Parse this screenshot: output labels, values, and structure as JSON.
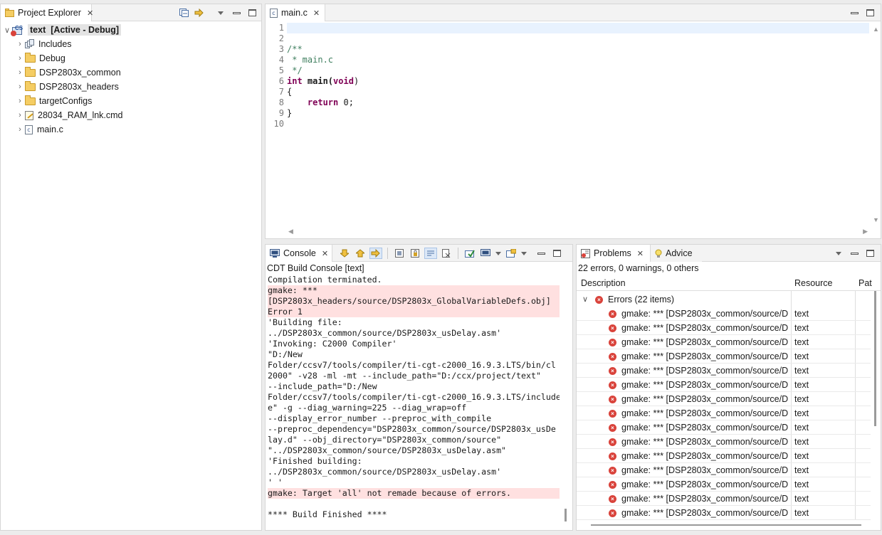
{
  "project_explorer": {
    "tab_label": "Project Explorer",
    "project": {
      "name": "text",
      "status": "[Active - Debug]"
    },
    "items": [
      {
        "label": "Includes",
        "icon": "includes-icon"
      },
      {
        "label": "Debug",
        "icon": "folder-icon"
      },
      {
        "label": "DSP2803x_common",
        "icon": "folder-icon"
      },
      {
        "label": "DSP2803x_headers",
        "icon": "folder-icon"
      },
      {
        "label": "targetConfigs",
        "icon": "folder-icon"
      },
      {
        "label": "28034_RAM_lnk.cmd",
        "icon": "linker-file-icon"
      },
      {
        "label": "main.c",
        "icon": "c-file-icon"
      }
    ]
  },
  "editor": {
    "tab_label": "main.c",
    "lines": [
      {
        "num": "1",
        "text": ""
      },
      {
        "num": "2",
        "text": ""
      },
      {
        "num": "3",
        "text": "/**"
      },
      {
        "num": "4",
        "text": " * main.c"
      },
      {
        "num": "5",
        "text": " */"
      },
      {
        "num": "6",
        "kw1": "int",
        "mid": " main(",
        "kw2": "void",
        "end": ")"
      },
      {
        "num": "7",
        "text": "{"
      },
      {
        "num": "8",
        "indent": "    ",
        "kw1": "return",
        "end": " 0;"
      },
      {
        "num": "9",
        "text": "}"
      },
      {
        "num": "10",
        "text": ""
      }
    ]
  },
  "console": {
    "tab_label": "Console",
    "title": "CDT Build Console [text]",
    "lines": [
      {
        "text": "Compilation terminated.",
        "error": false
      },
      {
        "text": "gmake: ***",
        "error": true
      },
      {
        "text": "[DSP2803x_headers/source/DSP2803x_GlobalVariableDefs.obj]",
        "error": true
      },
      {
        "text": "Error 1",
        "error": true
      },
      {
        "text": "'Building file:",
        "error": false
      },
      {
        "text": "../DSP2803x_common/source/DSP2803x_usDelay.asm'",
        "error": false
      },
      {
        "text": "'Invoking: C2000 Compiler'",
        "error": false
      },
      {
        "text": "\"D:/New",
        "error": false
      },
      {
        "text": "Folder/ccsv7/tools/compiler/ti-cgt-c2000_16.9.3.LTS/bin/cl",
        "error": false
      },
      {
        "text": "2000\" -v28 -ml -mt --include_path=\"D:/ccx/project/text\"",
        "error": false
      },
      {
        "text": "--include_path=\"D:/New",
        "error": false
      },
      {
        "text": "Folder/ccsv7/tools/compiler/ti-cgt-c2000_16.9.3.LTS/include",
        "error": false
      },
      {
        "text": "e\" -g --diag_warning=225 --diag_wrap=off",
        "error": false
      },
      {
        "text": "--display_error_number --preproc_with_compile",
        "error": false
      },
      {
        "text": "--preproc_dependency=\"DSP2803x_common/source/DSP2803x_usDe",
        "error": false
      },
      {
        "text": "lay.d\" --obj_directory=\"DSP2803x_common/source\"",
        "error": false
      },
      {
        "text": "\"../DSP2803x_common/source/DSP2803x_usDelay.asm\"",
        "error": false
      },
      {
        "text": "'Finished building:",
        "error": false
      },
      {
        "text": "../DSP2803x_common/source/DSP2803x_usDelay.asm'",
        "error": false
      },
      {
        "text": "' '",
        "error": false
      },
      {
        "text": "gmake: Target 'all' not remade because of errors.",
        "error": true
      },
      {
        "text": "",
        "error": false
      },
      {
        "text": "**** Build Finished ****",
        "error": false
      }
    ]
  },
  "problems": {
    "tab_label": "Problems",
    "advice_tab_label": "Advice",
    "summary": "22 errors, 0 warnings, 0 others",
    "columns": {
      "description": "Description",
      "resource": "Resource",
      "path": "Pat"
    },
    "group_label": "Errors (22 items)",
    "rows": [
      {
        "description": "gmake: *** [DSP2803x_common/source/D",
        "resource": "text"
      },
      {
        "description": "gmake: *** [DSP2803x_common/source/D",
        "resource": "text"
      },
      {
        "description": "gmake: *** [DSP2803x_common/source/D",
        "resource": "text"
      },
      {
        "description": "gmake: *** [DSP2803x_common/source/D",
        "resource": "text"
      },
      {
        "description": "gmake: *** [DSP2803x_common/source/D",
        "resource": "text"
      },
      {
        "description": "gmake: *** [DSP2803x_common/source/D",
        "resource": "text"
      },
      {
        "description": "gmake: *** [DSP2803x_common/source/D",
        "resource": "text"
      },
      {
        "description": "gmake: *** [DSP2803x_common/source/D",
        "resource": "text"
      },
      {
        "description": "gmake: *** [DSP2803x_common/source/D",
        "resource": "text"
      },
      {
        "description": "gmake: *** [DSP2803x_common/source/D",
        "resource": "text"
      },
      {
        "description": "gmake: *** [DSP2803x_common/source/D",
        "resource": "text"
      },
      {
        "description": "gmake: *** [DSP2803x_common/source/D",
        "resource": "text"
      },
      {
        "description": "gmake: *** [DSP2803x_common/source/D",
        "resource": "text"
      },
      {
        "description": "gmake: *** [DSP2803x_common/source/D",
        "resource": "text"
      },
      {
        "description": "gmake: *** [DSP2803x_common/source/D",
        "resource": "text"
      }
    ]
  },
  "colors": {
    "error_background": "#ffe0e0",
    "keyword": "#7f0055",
    "comment": "#3f7f5f",
    "current_line": "#e8f2fe"
  }
}
